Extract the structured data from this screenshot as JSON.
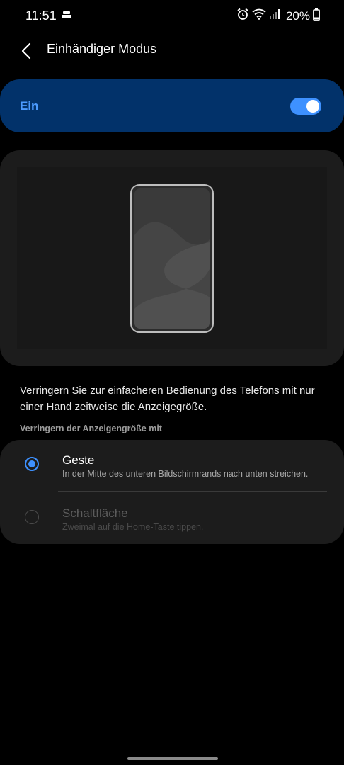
{
  "status_bar": {
    "time": "11:51",
    "battery": "20%"
  },
  "header": {
    "title": "Einhändiger Modus"
  },
  "master_switch": {
    "label": "Ein",
    "enabled": true
  },
  "description": "Verringern Sie zur einfacheren Bedienung des Telefons mit nur einer Hand zeitweise die Anzeigegröße.",
  "section_label": "Verringern der Anzeigengröße mit",
  "options": [
    {
      "title": "Geste",
      "subtitle": "In der Mitte des unteren Bildschirmrands nach unten streichen.",
      "selected": true,
      "enabled": true
    },
    {
      "title": "Schaltfläche",
      "subtitle": "Zweimal auf die Home-Taste tippen.",
      "selected": false,
      "enabled": false
    }
  ],
  "colors": {
    "accent": "#3e91ff",
    "switch_card_bg": "#02326a",
    "card_bg": "#1c1c1c"
  }
}
